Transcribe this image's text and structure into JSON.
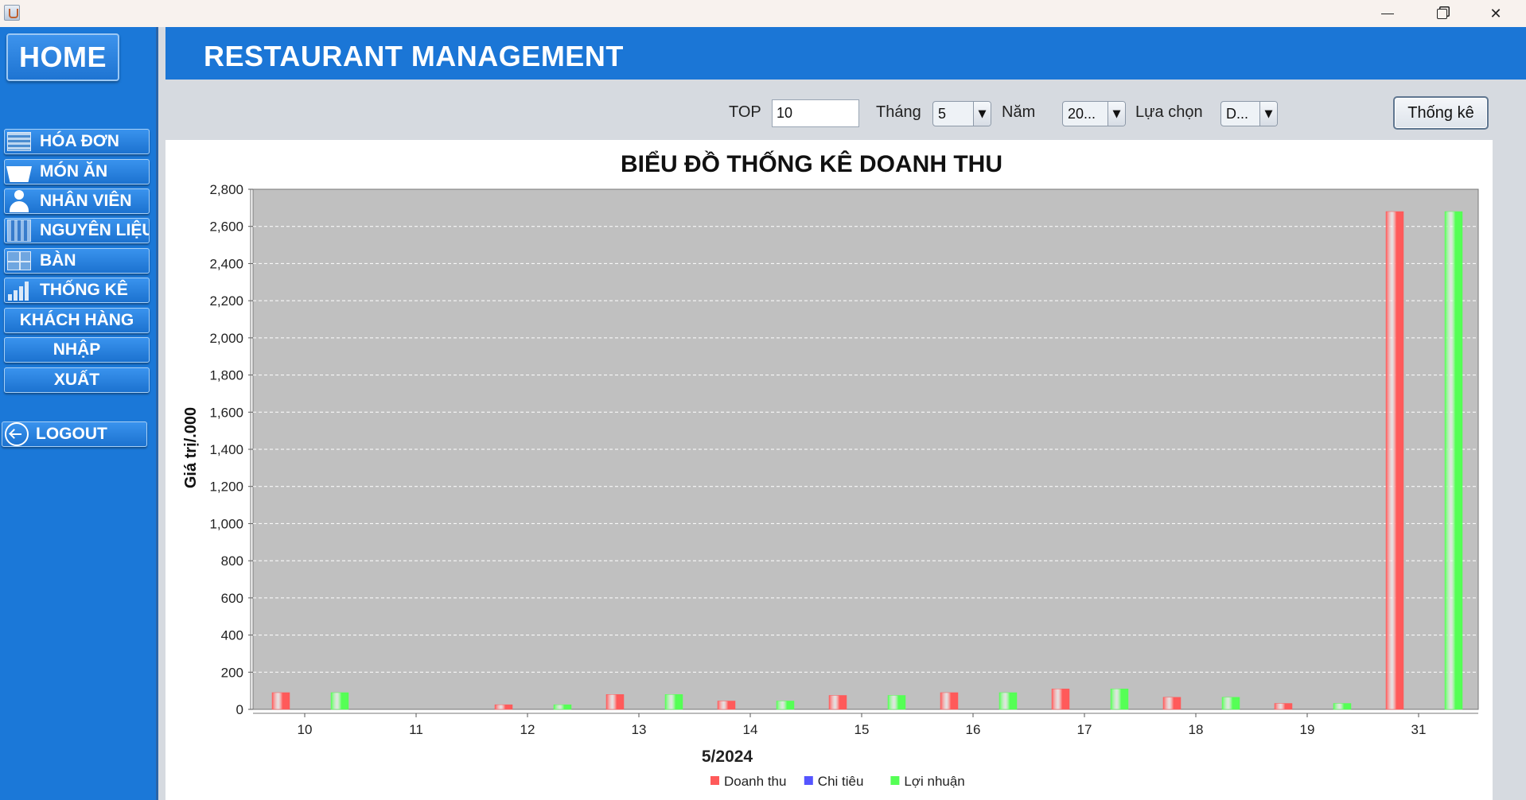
{
  "window": {
    "controls": [
      "minimize",
      "maximize",
      "close"
    ]
  },
  "sidebar": {
    "home_label": "HOME",
    "items": [
      {
        "label": "HÓA ĐƠN",
        "icon": "invoice-list-icon"
      },
      {
        "label": "MÓN ĂN",
        "icon": "basket-icon"
      },
      {
        "label": "NHÂN VIÊN",
        "icon": "add-user-icon"
      },
      {
        "label": "NGUYÊN LIỆU",
        "icon": "ingredients-grid-icon"
      },
      {
        "label": "BÀN",
        "icon": "table-icon"
      },
      {
        "label": "THỐNG KÊ",
        "icon": "bar-chart-icon"
      },
      {
        "label": "KHÁCH HÀNG",
        "icon": ""
      },
      {
        "label": "NHẬP",
        "icon": ""
      },
      {
        "label": "XUẤT",
        "icon": ""
      }
    ],
    "logout_label": "LOGOUT"
  },
  "header": {
    "title": "RESTAURANT MANAGEMENT"
  },
  "toolbar": {
    "top_label": "TOP",
    "top_value": "10",
    "month_label": "Tháng",
    "month_value": "5",
    "year_label": "Năm",
    "year_value": "20...",
    "choice_label": "Lựa chọn",
    "choice_value": "D...",
    "stat_button": "Thống kê"
  },
  "chart_data": {
    "type": "bar",
    "title": "BIỂU ĐỒ THỐNG KÊ DOANH THU",
    "xlabel": "5/2024",
    "ylabel": "Giá trị/.000",
    "ylim": [
      0,
      2800
    ],
    "yticks": [
      "0",
      "200",
      "400",
      "600",
      "800",
      "1,000",
      "1,200",
      "1,400",
      "1,600",
      "1,800",
      "2,000",
      "2,200",
      "2,400",
      "2,600",
      "2,800"
    ],
    "categories": [
      "10",
      "11",
      "12",
      "13",
      "14",
      "15",
      "16",
      "17",
      "18",
      "19",
      "31"
    ],
    "series": [
      {
        "name": "Doanh thu",
        "color": "#ff5a5a",
        "values": [
          90,
          0,
          25,
          80,
          45,
          75,
          90,
          110,
          65,
          32,
          2680
        ]
      },
      {
        "name": "Chi tiêu",
        "color": "#5555ff",
        "values": [
          0,
          0,
          0,
          0,
          0,
          0,
          0,
          0,
          0,
          0,
          0
        ]
      },
      {
        "name": "Lợi nhuận",
        "color": "#55ff55",
        "values": [
          90,
          0,
          25,
          80,
          45,
          75,
          90,
          110,
          65,
          32,
          2680
        ]
      }
    ],
    "grid": true,
    "legend": "bottom",
    "plot_background": "#c0c0c0"
  }
}
